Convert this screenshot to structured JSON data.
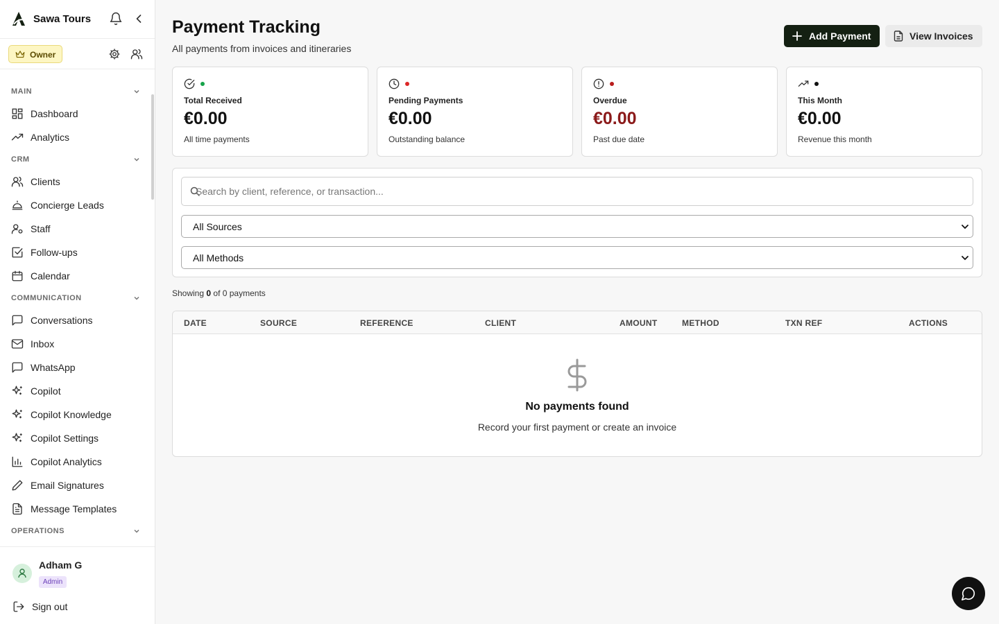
{
  "app": {
    "name": "Sawa Tours",
    "role": "Owner"
  },
  "sidebar": {
    "sections": [
      {
        "label": "MAIN",
        "items": [
          {
            "label": "Dashboard",
            "icon": "dashboard-icon"
          },
          {
            "label": "Analytics",
            "icon": "trending-up-icon"
          }
        ]
      },
      {
        "label": "CRM",
        "items": [
          {
            "label": "Clients",
            "icon": "users-icon"
          },
          {
            "label": "Concierge Leads",
            "icon": "concierge-bell-icon"
          },
          {
            "label": "Staff",
            "icon": "user-cog-icon"
          },
          {
            "label": "Follow-ups",
            "icon": "check-square-icon"
          },
          {
            "label": "Calendar",
            "icon": "calendar-icon"
          }
        ]
      },
      {
        "label": "COMMUNICATION",
        "items": [
          {
            "label": "Conversations",
            "icon": "message-square-icon"
          },
          {
            "label": "Inbox",
            "icon": "mail-icon"
          },
          {
            "label": "WhatsApp",
            "icon": "message-square-icon"
          },
          {
            "label": "Copilot",
            "icon": "sparkles-icon"
          },
          {
            "label": "Copilot Knowledge",
            "icon": "sparkles-icon"
          },
          {
            "label": "Copilot Settings",
            "icon": "sparkles-icon"
          },
          {
            "label": "Copilot Analytics",
            "icon": "bar-chart-icon"
          },
          {
            "label": "Email Signatures",
            "icon": "pen-icon"
          },
          {
            "label": "Message Templates",
            "icon": "file-text-icon"
          }
        ]
      },
      {
        "label": "OPERATIONS",
        "items": []
      }
    ]
  },
  "user": {
    "name": "Adham G",
    "badge": "Admin",
    "sign_out": "Sign out"
  },
  "header": {
    "title": "Payment Tracking",
    "subtitle": "All payments from invoices and itineraries",
    "add_button": "Add Payment",
    "view_button": "View Invoices"
  },
  "cards": [
    {
      "label": "Total Received",
      "value": "€0.00",
      "sub": "All time payments",
      "icon": "check-circle-icon",
      "dot_color": "#16a34a",
      "value_color": "#111111"
    },
    {
      "label": "Pending Payments",
      "value": "€0.00",
      "sub": "Outstanding balance",
      "icon": "clock-icon",
      "dot_color": "#dc2626",
      "value_color": "#111111"
    },
    {
      "label": "Overdue",
      "value": "€0.00",
      "sub": "Past due date",
      "icon": "alert-circle-icon",
      "dot_color": "#b91c1c",
      "value_color": "#8b1a1a"
    },
    {
      "label": "This Month",
      "value": "€0.00",
      "sub": "Revenue this month",
      "icon": "trending-up-icon",
      "dot_color": "#111111",
      "value_color": "#111111"
    }
  ],
  "filters": {
    "search_placeholder": "Search by client, reference, or transaction...",
    "source": "All Sources",
    "method": "All Methods"
  },
  "results": {
    "prefix": "Showing",
    "shown": "0",
    "middle": "of 0 payments"
  },
  "table": {
    "columns": [
      "DATE",
      "SOURCE",
      "REFERENCE",
      "CLIENT",
      "AMOUNT",
      "METHOD",
      "TXN REF",
      "ACTIONS"
    ],
    "empty_title": "No payments found",
    "empty_sub": "Record your first payment or create an invoice"
  }
}
